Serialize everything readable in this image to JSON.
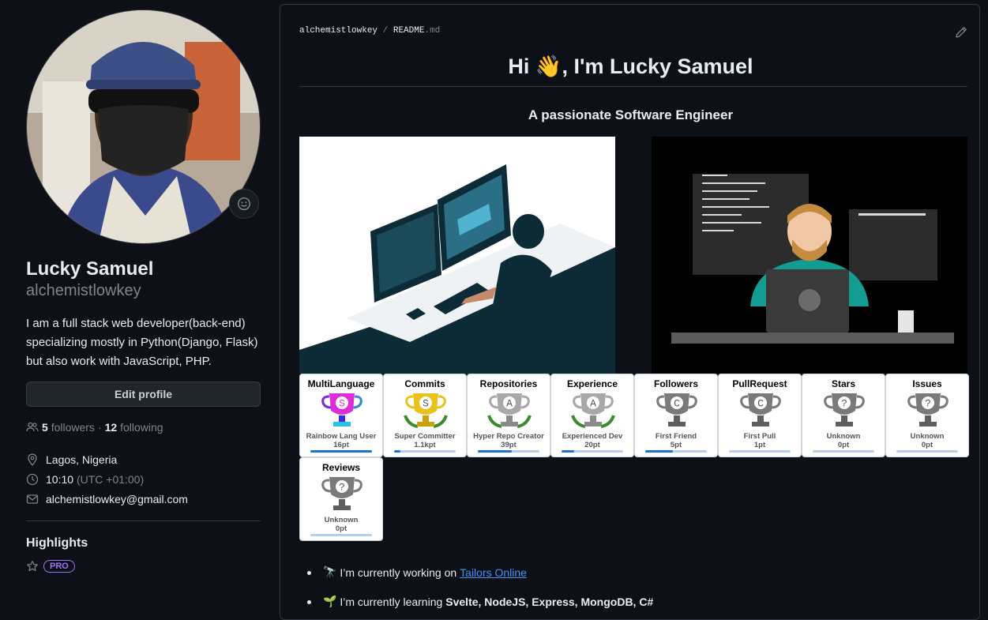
{
  "profile": {
    "name": "Lucky Samuel",
    "login": "alchemistlowkey",
    "bio": "I am a full stack web developer(back-end) specializing mostly in Python(Django, Flask) but also work with JavaScript, PHP.",
    "edit_label": "Edit profile",
    "followers_count": "5",
    "followers_label": "followers",
    "separator": "·",
    "following_count": "12",
    "following_label": "following",
    "location": "Lagos, Nigeria",
    "time": "10:10",
    "timezone": "(UTC +01:00)",
    "email": "alchemistlowkey@gmail.com",
    "highlights_title": "Highlights",
    "pro_badge": "PRO"
  },
  "readme": {
    "crumb_owner": "alchemistlowkey",
    "crumb_sep": "/",
    "crumb_file": "README",
    "crumb_ext": ".md",
    "heading": "Hi 👋, I'm Lucky Samuel",
    "subheading": "A passionate Software Engineer",
    "trophies": [
      {
        "title": "MultiLanguage",
        "rank": "Rainbow Lang User",
        "points": "16pt",
        "letter": "S",
        "progress": 1.0
      },
      {
        "title": "Commits",
        "rank": "Super Committer",
        "points": "1.1kpt",
        "letter": "S",
        "progress": 0.1
      },
      {
        "title": "Repositories",
        "rank": "Hyper Repo Creator",
        "points": "39pt",
        "letter": "A",
        "progress": 0.55
      },
      {
        "title": "Experience",
        "rank": "Experienced Dev",
        "points": "20pt",
        "letter": "A",
        "progress": 0.2
      },
      {
        "title": "Followers",
        "rank": "First Friend",
        "points": "5pt",
        "letter": "C",
        "progress": 0.45
      },
      {
        "title": "PullRequest",
        "rank": "First Pull",
        "points": "1pt",
        "letter": "C",
        "progress": 0.0
      },
      {
        "title": "Stars",
        "rank": "Unknown",
        "points": "0pt",
        "letter": "?",
        "progress": 0.0
      },
      {
        "title": "Issues",
        "rank": "Unknown",
        "points": "0pt",
        "letter": "?",
        "progress": 0.0
      },
      {
        "title": "Reviews",
        "rank": "Unknown",
        "points": "0pt",
        "letter": "?",
        "progress": 0.0
      }
    ],
    "list": [
      {
        "emoji": "🔭",
        "text": "I’m currently working on",
        "link": "Tailors Online"
      },
      {
        "emoji": "🌱",
        "text": "I’m currently learning",
        "bold": "Svelte, NodeJS, Express, MongoDB, C#"
      }
    ]
  },
  "colors": {
    "background": "#0d1117",
    "border": "#30363d",
    "muted": "#7d8590",
    "link": "#4493f8",
    "pro": "#a371f7"
  }
}
